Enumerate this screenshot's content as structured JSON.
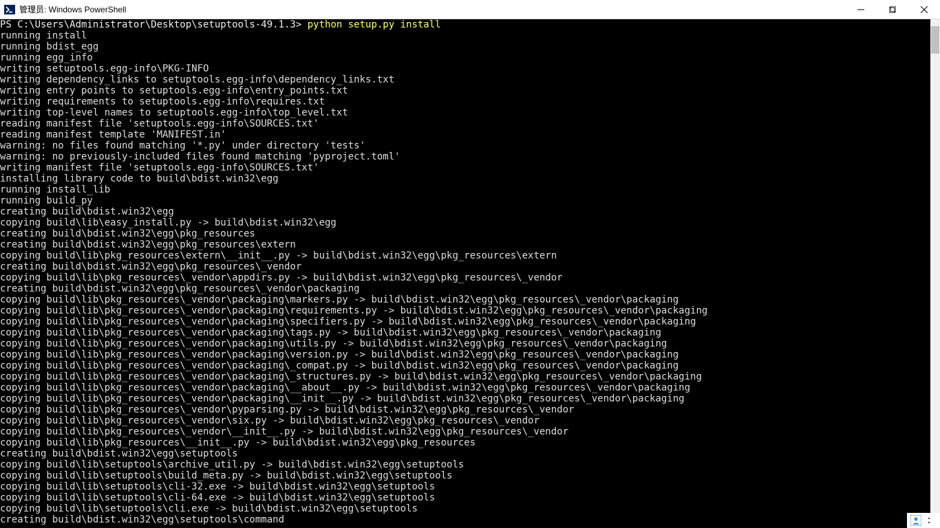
{
  "window": {
    "title": "管理员: Windows PowerShell"
  },
  "terminal": {
    "prompt": "PS C:\\Users\\Administrator\\Desktop\\setuptools-49.1.3> ",
    "command": "python setup.py install",
    "lines": [
      "running install",
      "running bdist_egg",
      "running egg_info",
      "writing setuptools.egg-info\\PKG-INFO",
      "writing dependency_links to setuptools.egg-info\\dependency_links.txt",
      "writing entry points to setuptools.egg-info\\entry_points.txt",
      "writing requirements to setuptools.egg-info\\requires.txt",
      "writing top-level names to setuptools.egg-info\\top_level.txt",
      "reading manifest file 'setuptools.egg-info\\SOURCES.txt'",
      "reading manifest template 'MANIFEST.in'",
      "warning: no files found matching '*.py' under directory 'tests'",
      "warning: no previously-included files found matching 'pyproject.toml'",
      "writing manifest file 'setuptools.egg-info\\SOURCES.txt'",
      "installing library code to build\\bdist.win32\\egg",
      "running install_lib",
      "running build_py",
      "creating build\\bdist.win32\\egg",
      "copying build\\lib\\easy_install.py -> build\\bdist.win32\\egg",
      "creating build\\bdist.win32\\egg\\pkg_resources",
      "creating build\\bdist.win32\\egg\\pkg_resources\\extern",
      "copying build\\lib\\pkg_resources\\extern\\__init__.py -> build\\bdist.win32\\egg\\pkg_resources\\extern",
      "creating build\\bdist.win32\\egg\\pkg_resources\\_vendor",
      "copying build\\lib\\pkg_resources\\_vendor\\appdirs.py -> build\\bdist.win32\\egg\\pkg_resources\\_vendor",
      "creating build\\bdist.win32\\egg\\pkg_resources\\_vendor\\packaging",
      "copying build\\lib\\pkg_resources\\_vendor\\packaging\\markers.py -> build\\bdist.win32\\egg\\pkg_resources\\_vendor\\packaging",
      "copying build\\lib\\pkg_resources\\_vendor\\packaging\\requirements.py -> build\\bdist.win32\\egg\\pkg_resources\\_vendor\\packaging",
      "copying build\\lib\\pkg_resources\\_vendor\\packaging\\specifiers.py -> build\\bdist.win32\\egg\\pkg_resources\\_vendor\\packaging",
      "copying build\\lib\\pkg_resources\\_vendor\\packaging\\tags.py -> build\\bdist.win32\\egg\\pkg_resources\\_vendor\\packaging",
      "copying build\\lib\\pkg_resources\\_vendor\\packaging\\utils.py -> build\\bdist.win32\\egg\\pkg_resources\\_vendor\\packaging",
      "copying build\\lib\\pkg_resources\\_vendor\\packaging\\version.py -> build\\bdist.win32\\egg\\pkg_resources\\_vendor\\packaging",
      "copying build\\lib\\pkg_resources\\_vendor\\packaging\\_compat.py -> build\\bdist.win32\\egg\\pkg_resources\\_vendor\\packaging",
      "copying build\\lib\\pkg_resources\\_vendor\\packaging\\_structures.py -> build\\bdist.win32\\egg\\pkg_resources\\_vendor\\packaging",
      "copying build\\lib\\pkg_resources\\_vendor\\packaging\\__about__.py -> build\\bdist.win32\\egg\\pkg_resources\\_vendor\\packaging",
      "copying build\\lib\\pkg_resources\\_vendor\\packaging\\__init__.py -> build\\bdist.win32\\egg\\pkg_resources\\_vendor\\packaging",
      "copying build\\lib\\pkg_resources\\_vendor\\pyparsing.py -> build\\bdist.win32\\egg\\pkg_resources\\_vendor",
      "copying build\\lib\\pkg_resources\\_vendor\\six.py -> build\\bdist.win32\\egg\\pkg_resources\\_vendor",
      "copying build\\lib\\pkg_resources\\_vendor\\__init__.py -> build\\bdist.win32\\egg\\pkg_resources\\_vendor",
      "copying build\\lib\\pkg_resources\\__init__.py -> build\\bdist.win32\\egg\\pkg_resources",
      "creating build\\bdist.win32\\egg\\setuptools",
      "copying build\\lib\\setuptools\\archive_util.py -> build\\bdist.win32\\egg\\setuptools",
      "copying build\\lib\\setuptools\\build_meta.py -> build\\bdist.win32\\egg\\setuptools",
      "copying build\\lib\\setuptools\\cli-32.exe -> build\\bdist.win32\\egg\\setuptools",
      "copying build\\lib\\setuptools\\cli-64.exe -> build\\bdist.win32\\egg\\setuptools",
      "copying build\\lib\\setuptools\\cli.exe -> build\\bdist.win32\\egg\\setuptools",
      "creating build\\bdist.win32\\egg\\setuptools\\command"
    ]
  }
}
